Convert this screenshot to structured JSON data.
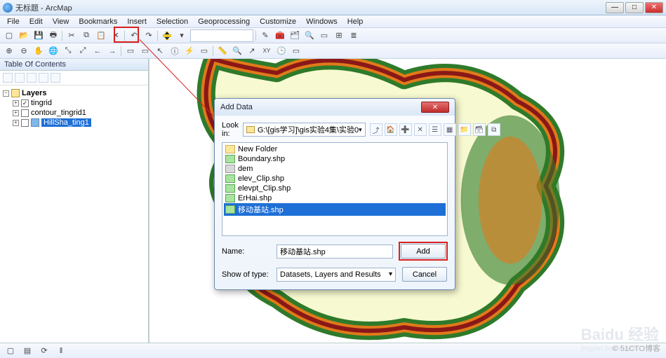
{
  "window": {
    "title": "无标题 - ArcMap",
    "min": "—",
    "max": "□",
    "close": "✕"
  },
  "menu": [
    "File",
    "Edit",
    "View",
    "Bookmarks",
    "Insert",
    "Selection",
    "Geoprocessing",
    "Customize",
    "Windows",
    "Help"
  ],
  "toc": {
    "title": "Table Of Contents",
    "root": "Layers",
    "items": [
      {
        "label": "tingrid",
        "checked": true
      },
      {
        "label": "contour_tingrid1",
        "checked": false
      },
      {
        "label": "HillSha_ting1",
        "checked": false,
        "selected": true
      }
    ]
  },
  "dialog": {
    "title": "Add Data",
    "lookin_label": "Look in:",
    "lookin_value": "G:\\[gis学习]\\gis实验4集\\实验0",
    "files": [
      {
        "name": "New Folder",
        "type": "folder"
      },
      {
        "name": "Boundary.shp",
        "type": "shp"
      },
      {
        "name": "dem",
        "type": "raster"
      },
      {
        "name": "elev_Clip.shp",
        "type": "shp"
      },
      {
        "name": "elevpt_Clip.shp",
        "type": "shp"
      },
      {
        "name": "ErHai.shp",
        "type": "shp"
      },
      {
        "name": "移动基站.shp",
        "type": "shp",
        "selected": true
      }
    ],
    "name_label": "Name:",
    "name_value": "移动基站.shp",
    "type_label": "Show of type:",
    "type_value": "Datasets, Layers and Results",
    "add": "Add",
    "cancel": "Cancel"
  },
  "watermark": {
    "brand": "Baidu 经验",
    "url": "jingyan.baidu.com",
    "cto": "© 51CTO博客"
  }
}
